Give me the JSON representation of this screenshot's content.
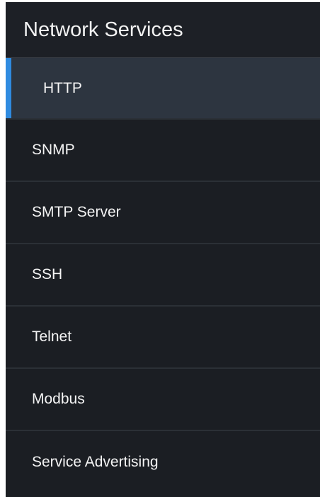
{
  "panel": {
    "title": "Network Services",
    "items": [
      {
        "label": "HTTP",
        "active": true
      },
      {
        "label": "SNMP",
        "active": false
      },
      {
        "label": "SMTP Server",
        "active": false
      },
      {
        "label": "SSH",
        "active": false
      },
      {
        "label": "Telnet",
        "active": false
      },
      {
        "label": "Modbus",
        "active": false
      },
      {
        "label": "Service Advertising",
        "active": false
      }
    ]
  },
  "colors": {
    "background": "#1b1e23",
    "active_background": "#2d3540",
    "accent": "#2f8be0",
    "text": "#f4f4f4",
    "divider": "#2b3036"
  }
}
